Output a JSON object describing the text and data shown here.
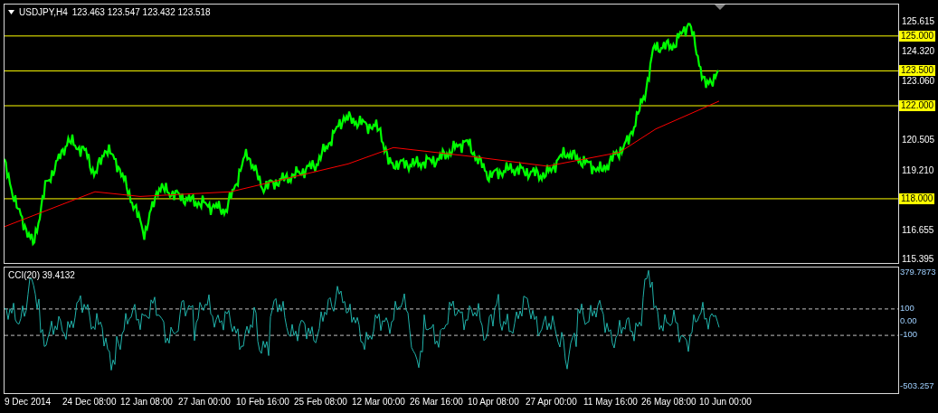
{
  "header": {
    "symbol": "USDJPY,H4",
    "quote": "123.463 123.547 123.432 123.518"
  },
  "price_axis": {
    "ticks": [
      "125.615",
      "124.320",
      "123.060",
      "120.505",
      "119.210",
      "116.655",
      "115.395"
    ]
  },
  "levels": [
    "125.000",
    "123.500",
    "122.000",
    "118.000"
  ],
  "indicator": {
    "title": "CCI(20) 39.4132",
    "ticks": [
      "379.7873",
      "100",
      "0.00",
      "-100",
      "-503.257"
    ]
  },
  "time_axis": [
    "9 Dec 2014",
    "24 Dec 08:00",
    "12 Jan 08:00",
    "27 Jan 00:00",
    "10 Feb 16:00",
    "25 Feb 08:00",
    "12 Mar 00:00",
    "26 Mar 16:00",
    "10 Apr 08:00",
    "27 Apr 00:00",
    "11 May 16:00",
    "26 May 08:00",
    "10 Jun 00:00"
  ]
}
